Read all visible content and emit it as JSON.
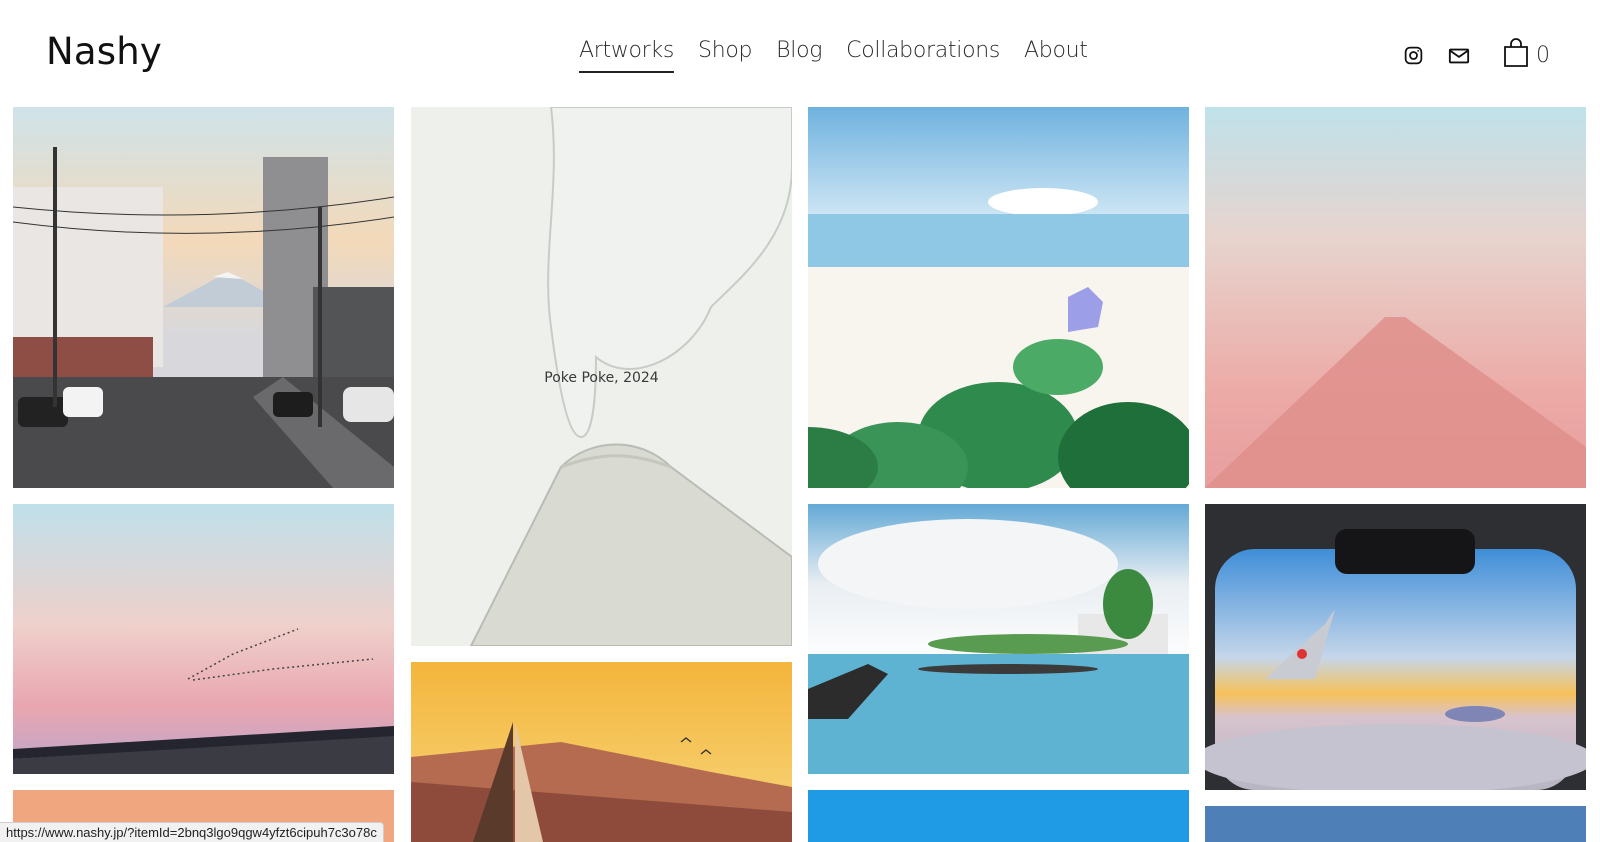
{
  "site": {
    "title": "Nashy"
  },
  "nav": {
    "items": [
      {
        "label": "Artworks",
        "active": true
      },
      {
        "label": "Shop"
      },
      {
        "label": "Blog"
      },
      {
        "label": "Collaborations"
      },
      {
        "label": "About"
      }
    ]
  },
  "header_icons": {
    "instagram": "instagram-icon",
    "mail": "mail-icon",
    "cart": "shopping-bag-icon"
  },
  "cart": {
    "count": "0"
  },
  "gallery": {
    "hover_caption": "Poke Poke, 2024"
  },
  "status_bar": {
    "url": "https://www.nashy.jp/?itemId=2bnq3lgo9qgw4yfzt6cipuh7c3o78c"
  }
}
